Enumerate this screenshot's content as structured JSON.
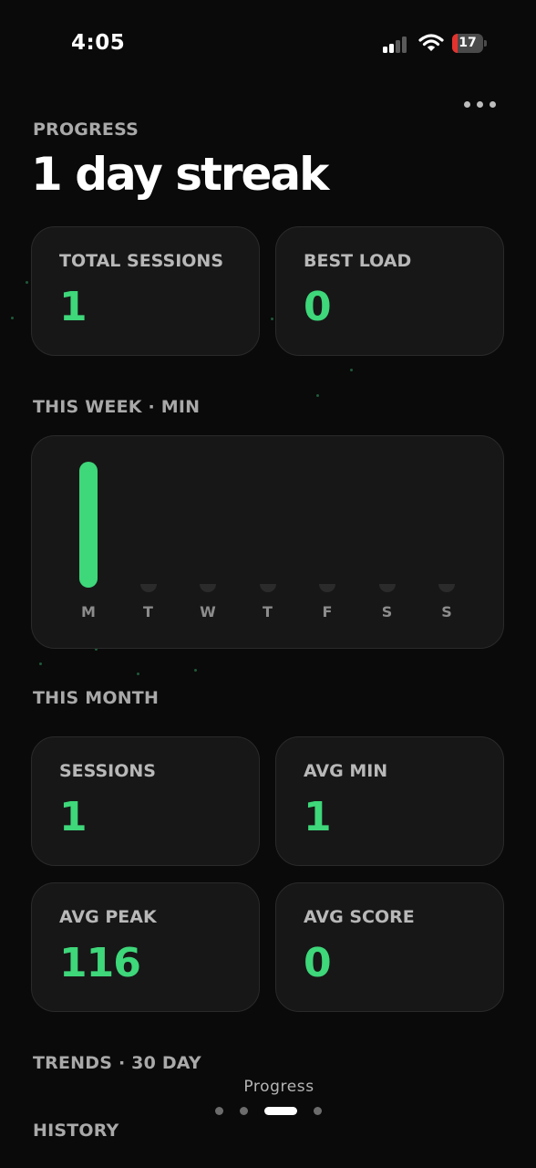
{
  "status_bar": {
    "time": "4:05",
    "battery_level": "17",
    "battery_percent": 17,
    "signal_bars_active": 2,
    "signal_bars_total": 4
  },
  "header": {
    "section_label": "PROGRESS",
    "title": "1 day streak",
    "more_icon": "ellipsis-icon"
  },
  "summary": {
    "total_sessions": {
      "label": "TOTAL SESSIONS",
      "value": "1"
    },
    "best_load": {
      "label": "BEST LOAD",
      "value": "0"
    }
  },
  "week": {
    "section_label": "THIS WEEK · MIN",
    "days": [
      {
        "label": "M",
        "minutes_fraction": 1.0
      },
      {
        "label": "T",
        "minutes_fraction": 0
      },
      {
        "label": "W",
        "minutes_fraction": 0
      },
      {
        "label": "T",
        "minutes_fraction": 0
      },
      {
        "label": "F",
        "minutes_fraction": 0
      },
      {
        "label": "S",
        "minutes_fraction": 0
      },
      {
        "label": "S",
        "minutes_fraction": 0
      }
    ]
  },
  "month": {
    "section_label": "THIS MONTH",
    "sessions": {
      "label": "SESSIONS",
      "value": "1"
    },
    "avg_min": {
      "label": "AVG MIN",
      "value": "1"
    },
    "avg_peak": {
      "label": "AVG PEAK",
      "value": "116"
    },
    "avg_score": {
      "label": "AVG SCORE",
      "value": "0"
    }
  },
  "trends": {
    "section_label": "TRENDS · 30 DAY"
  },
  "history": {
    "section_label": "HISTORY"
  },
  "pager": {
    "label": "Progress",
    "page_count": 4,
    "active_index": 2
  },
  "colors": {
    "accent": "#3ed77a",
    "background": "#0a0a0a",
    "card": "#171717",
    "battery_low": "#e5322d"
  }
}
